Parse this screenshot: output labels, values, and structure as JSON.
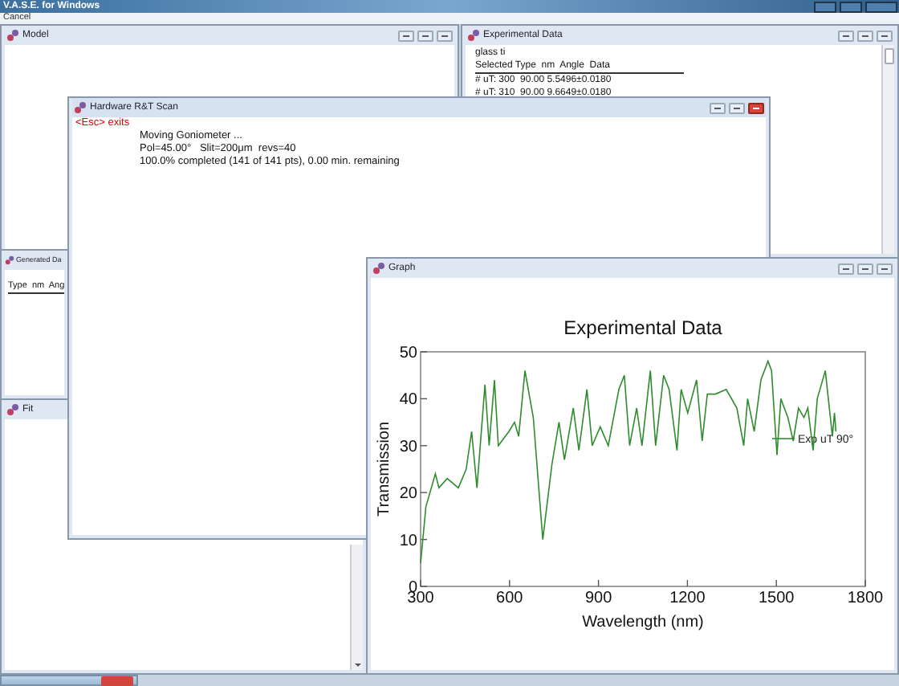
{
  "app": {
    "title": "V.A.S.E. for Windows",
    "menu": [
      "Cancel"
    ]
  },
  "windows": [
    {
      "kind": "model",
      "title": "Model",
      "active": false
    },
    {
      "kind": "data",
      "title": "Experimental Data",
      "active": false,
      "lines": [
        "glass ti"
      ],
      "header": "Selected Type  nm  Angle  Data",
      "rows": [
        "# uT: 300  90.00 5.5496±0.0180",
        "# uT: 310  90.00 9.6649±0.0180"
      ]
    },
    {
      "kind": "generated",
      "title": "Generated Da",
      "header": "Type  nm  Ang"
    },
    {
      "kind": "fit",
      "title": "Fit"
    },
    {
      "kind": "scan",
      "title": "Hardware R&T Scan",
      "active": true,
      "exit": "<Esc> exits",
      "lines": [
        "Moving Goniometer ...",
        "Pol=45.00°   Slit=200μm  revs=40",
        "100.0% completed (141 of 141 pts), 0.00 min. remaining"
      ]
    },
    {
      "kind": "graph",
      "title": "Graph",
      "active": false,
      "chart_data": {
        "type": "line",
        "title": "Experimental Data",
        "xlabel": "Wavelength (nm)",
        "ylabel": "Transmission",
        "xlim": [
          300,
          1800
        ],
        "ylim": [
          0,
          50
        ],
        "xticks": [
          300,
          600,
          900,
          1200,
          1500,
          1800
        ],
        "yticks": [
          0,
          10,
          20,
          30,
          40,
          50
        ],
        "x": [
          300,
          318,
          350,
          362,
          390,
          427,
          454,
          472,
          490,
          517,
          531,
          549,
          562,
          598,
          617,
          631,
          652,
          680,
          712,
          743,
          767,
          785,
          815,
          834,
          861,
          879,
          906,
          933,
          969,
          987,
          1005,
          1029,
          1047,
          1075,
          1093,
          1120,
          1138,
          1165,
          1179,
          1201,
          1231,
          1250,
          1267,
          1294,
          1331,
          1367,
          1390,
          1403,
          1425,
          1448,
          1472,
          1484,
          1502,
          1515,
          1539,
          1557,
          1575,
          1593,
          1606,
          1624,
          1638,
          1665,
          1689,
          1696,
          1701
        ],
        "series": [
          {
            "name": "Exp uT 90°",
            "color": "#2e8b2e",
            "values": [
              5,
              17,
              24,
              21,
              23,
              21,
              25,
              33,
              21,
              43,
              30,
              44,
              30,
              33,
              35,
              32,
              46,
              36,
              10,
              26,
              35,
              27,
              38,
              29,
              42,
              30,
              34,
              30,
              42,
              45,
              30,
              38,
              30,
              46,
              30,
              45,
              42,
              29,
              42,
              37,
              44,
              31,
              41,
              41,
              42,
              38,
              30,
              40,
              33,
              44,
              48,
              46,
              28,
              40,
              36,
              31,
              38,
              36,
              38,
              29,
              40,
              46,
              32,
              37,
              33
            ]
          }
        ]
      }
    }
  ]
}
